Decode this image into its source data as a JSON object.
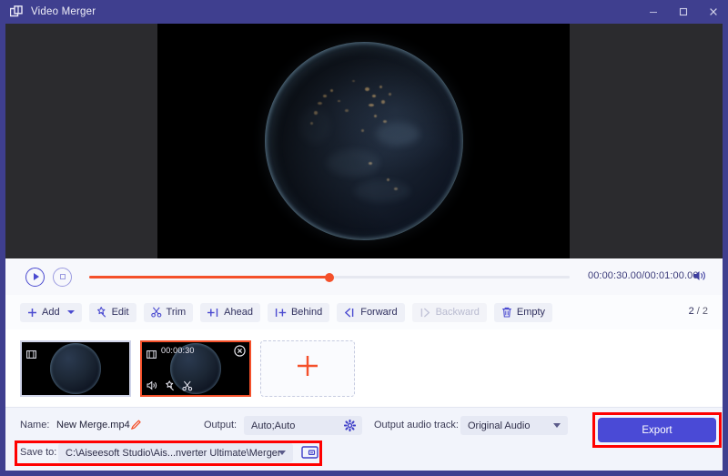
{
  "window": {
    "title": "Video Merger",
    "app_icon": "video-merger-icon",
    "controls": [
      {
        "name": "minimize",
        "glyph": "–"
      },
      {
        "name": "maximize",
        "glyph": "□"
      },
      {
        "name": "close",
        "glyph": "✕"
      }
    ],
    "titlebar_color": "#3f3f8f"
  },
  "preview": {
    "background": "#2b2b2e",
    "video_background": "#000000",
    "content": "earth-at-night-video-frame"
  },
  "player": {
    "play_button": "play-icon",
    "stop_button": "stop-icon",
    "progress_percent": 50,
    "current_time": "00:00:30.00",
    "total_time": "00:01:00.00",
    "time_display": "00:00:30.00/00:01:00.00",
    "volume_icon": "speaker-icon",
    "accent_color": "#f4502a"
  },
  "toolbar": {
    "buttons": [
      {
        "label": "Add",
        "icon": "plus-icon",
        "has_dropdown": true,
        "disabled": false
      },
      {
        "label": "Edit",
        "icon": "magic-wand-icon",
        "has_dropdown": false,
        "disabled": false
      },
      {
        "label": "Trim",
        "icon": "scissors-icon",
        "has_dropdown": false,
        "disabled": false
      },
      {
        "label": "Ahead",
        "icon": "insert-ahead-icon",
        "has_dropdown": false,
        "disabled": false
      },
      {
        "label": "Behind",
        "icon": "insert-behind-icon",
        "has_dropdown": false,
        "disabled": false
      },
      {
        "label": "Forward",
        "icon": "move-forward-icon",
        "has_dropdown": false,
        "disabled": false
      },
      {
        "label": "Backward",
        "icon": "move-backward-icon",
        "has_dropdown": false,
        "disabled": true
      },
      {
        "label": "Empty",
        "icon": "trash-icon",
        "has_dropdown": false,
        "disabled": false
      }
    ],
    "counter_current": "2",
    "counter_separator": "/",
    "counter_total": "2"
  },
  "clips": [
    {
      "duration": "",
      "selected": false,
      "film_icon": "film-strip-icon",
      "tools": []
    },
    {
      "duration": "00:00:30",
      "selected": true,
      "film_icon": "film-strip-icon",
      "close_icon": "close-circle-icon",
      "tools": [
        "speaker-icon",
        "magic-wand-icon",
        "scissors-icon"
      ]
    }
  ],
  "add_card": {
    "icon": "plus-icon",
    "color": "#f4502a"
  },
  "footer": {
    "name_label": "Name:",
    "name_value": "New Merge.mp4",
    "name_edit_icon": "pencil-icon",
    "output_label": "Output:",
    "output_value": "Auto;Auto",
    "output_settings_icon": "gear-icon",
    "audio_track_label": "Output audio track:",
    "audio_track_value": "Original Audio",
    "save_to_label": "Save to:",
    "save_to_value": "C:\\Aiseesoft Studio\\Ais...nverter Ultimate\\Merger",
    "folder_icon": "folder-open-icon",
    "export_label": "Export",
    "export_color": "#4a4ad6"
  },
  "annotations": {
    "highlight_color": "#ff0000",
    "regions": [
      "save-to-row",
      "export-button"
    ]
  }
}
